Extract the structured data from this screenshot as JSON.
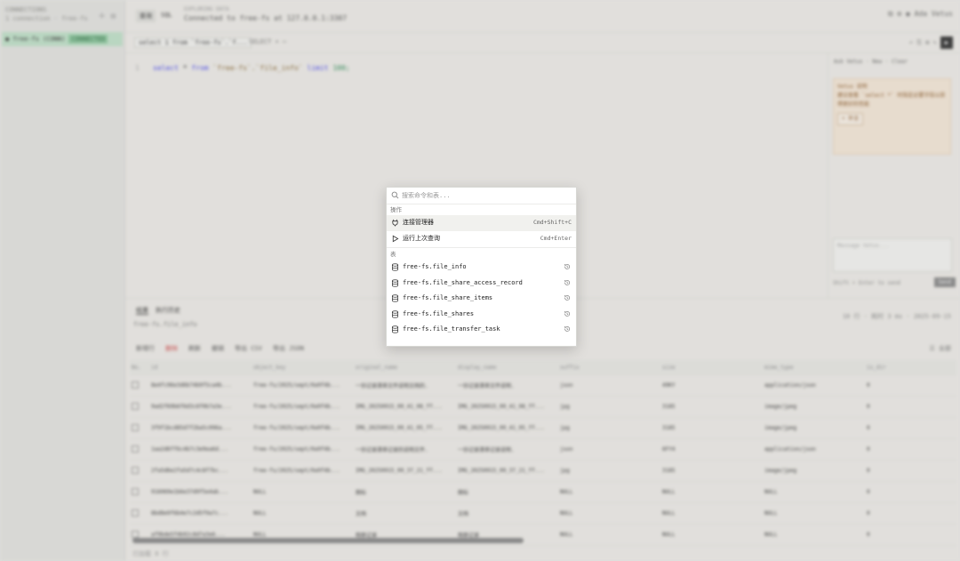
{
  "sidebar": {
    "heading": "CONNECTIONS",
    "subheading": "1 connection · free-fs",
    "connection_name": "● free-fs (CONN)",
    "connection_tag": "CONNECTED"
  },
  "header": {
    "tab_active": "查询",
    "tab_other": "SQL",
    "status_label": "EXPLORING DATA",
    "connection_text": "Connected to free-fs at 127.0.0.1:3307",
    "user_label": "Ada Vetus"
  },
  "toolbar": {
    "db_select": "select 1 from `free-fs`.`f...",
    "limit_select": "SELECT ▾  ⋯"
  },
  "editor": {
    "line_number": "1",
    "code_kw1": "select",
    "code_mid1": " * ",
    "code_kw2": "from",
    "code_tbl": " `free-fs`.`file_info` ",
    "code_kw3": "limit",
    "code_num": " 100;"
  },
  "ai_panel": {
    "header": "Ask Vetus · New · Clear",
    "card_title": "Vetus 说明",
    "card_body": "建议查看 `select *` 时指定必要字段以获得更好的性能",
    "card_button": "+ 补全",
    "input_placeholder": "Message Vetus...",
    "footer": "Shift + Enter to send",
    "send_label": "Send"
  },
  "results": {
    "tabs": [
      "结果",
      "执行历史"
    ],
    "path": "free-fs.file_info",
    "meta": "10 行 · 耗时 3 ms · 2025-09-15",
    "actions": [
      "新增行",
      "删除",
      "刷新",
      "撤销",
      "导出 CSV",
      "导出 JSON"
    ],
    "actions_right": "☰ 全部",
    "columns": [
      "No.",
      "id",
      "object_key",
      "original_name",
      "display_name",
      "suffix",
      "size",
      "mime_type",
      "is_dir"
    ],
    "rows": [
      [
        "",
        "8e4fc96e3d6b74b9f5ca4b...",
        "free-fs/2025/sept/0a9f4b...",
        "一份记录清单文件说明文档的.",
        "一份记录清单文件说明.",
        "json",
        "49KY",
        "application/json",
        "0"
      ],
      [
        "",
        "9ad2f69b6f6d3c6f0b7a3e...",
        "free-fs/2025/sept/0a9f4b...",
        "IMG_20250915_09_41_08_ff...",
        "IMG_20250915_09_41_08_ff...",
        "jpg",
        "3185",
        "image/jpeg",
        "0"
      ],
      [
        "",
        "3f9f1bcd85d7f2ba5c096a...",
        "free-fs/2025/sept/0a9f4b...",
        "IMG_20250915_09_41_05_ff...",
        "IMG_20250915_09_41_05_ff...",
        "jpg",
        "3185",
        "image/jpeg",
        "0"
      ],
      [
        "",
        "1aa2d6ff6c4b7c3e9ea6d...",
        "free-fs/2025/sept/0a9f4b...",
        "一份记录清单记录的说明文件.",
        "一份记录清单记录说明.",
        "json",
        "6FY4",
        "application/json",
        "0"
      ],
      [
        "",
        "2fa5d6e2fa5d7c4c8f7bc...",
        "free-fs/2025/sept/0a9f4b...",
        "IMG_20250915_09_37_21_ff...",
        "IMG_20250915_09_37_21_ff...",
        "jpg",
        "3185",
        "image/jpeg",
        "0"
      ],
      [
        "",
        "916069e1b6e37d9f5e4ab...",
        "NULL",
        "图标",
        "图标",
        "NULL",
        "NULL",
        "NULL",
        "0"
      ],
      [
        "",
        "8bd8e9f6b4e7c2d5f9a7c...",
        "NULL",
        "文档",
        "文档",
        "NULL",
        "NULL",
        "NULL",
        "0"
      ],
      [
        "",
        "af9bde5f4b92c8d7a3e6...",
        "NULL",
        "相册记录",
        "相册记录",
        "NULL",
        "NULL",
        "NULL",
        "0"
      ]
    ],
    "footer": "已加载 8 行"
  },
  "palette": {
    "search_placeholder": "搜索命令和表...",
    "group_actions": "操作",
    "actions": [
      {
        "label": "连接管理器",
        "shortcut": "Cmd+Shift+C",
        "icon": "plug-icon"
      },
      {
        "label": "运行上次查询",
        "shortcut": "Cmd+Enter",
        "icon": "play-icon"
      }
    ],
    "group_tables": "表",
    "tables": [
      "free-fs.file_info",
      "free-fs.file_share_access_record",
      "free-fs.file_share_items",
      "free-fs.file_shares",
      "free-fs.file_transfer_task"
    ]
  }
}
